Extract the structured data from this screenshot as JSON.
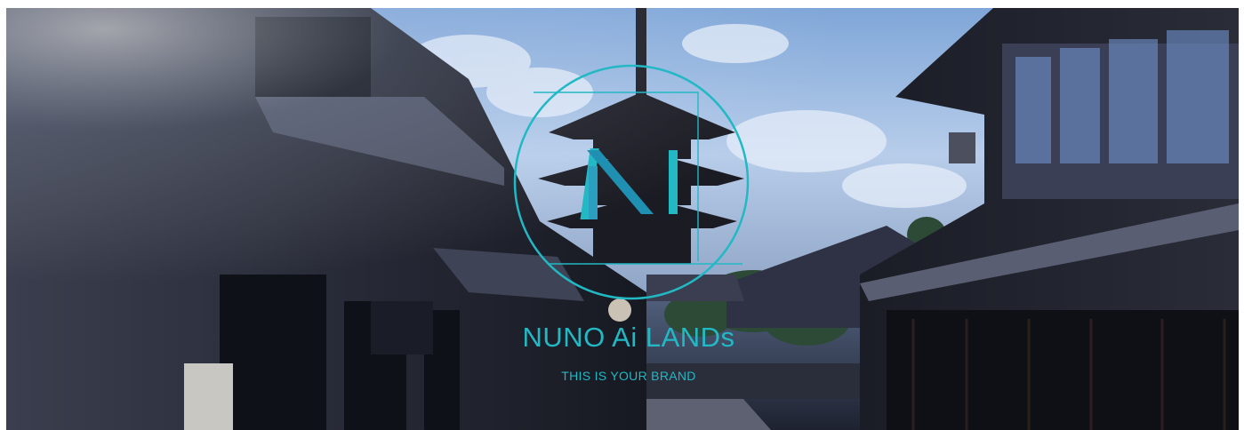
{
  "hero": {
    "background_image": "kyoto-street-pagoda-photo",
    "logo_icon": "n-monogram-circle-logo-icon",
    "title": "NUNO Ai LANDs",
    "tagline": "THIS IS YOUR BRAND",
    "accent_color": "#22b8c4"
  }
}
